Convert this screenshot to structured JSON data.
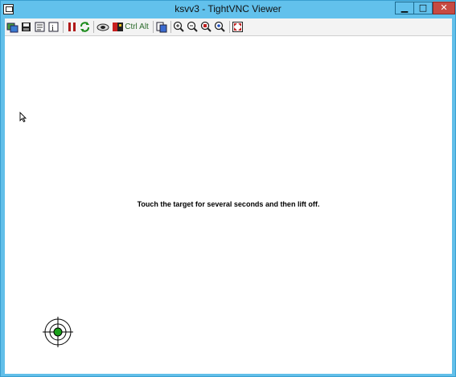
{
  "window": {
    "title": "ksvv3 - TightVNC Viewer",
    "minimize_glyph": "▁",
    "maximize_glyph": "□",
    "close_glyph": "✕"
  },
  "toolbar": {
    "ctrl_label": "Ctrl",
    "alt_label": "Alt"
  },
  "remote": {
    "instruction": "Touch the target for several seconds and then lift off."
  }
}
